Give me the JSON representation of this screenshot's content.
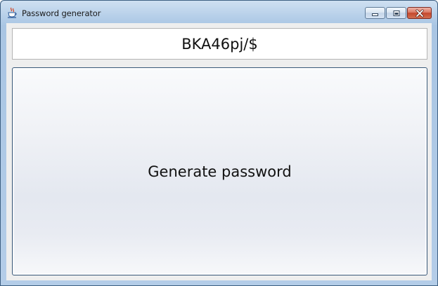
{
  "window": {
    "title": "Password generator",
    "icon": "java-cup-icon"
  },
  "caption_buttons": {
    "minimize": "minimize-icon",
    "restore": "restore-icon",
    "close": "close-icon"
  },
  "password_field": {
    "value": "BKA46pj/$"
  },
  "generate_button": {
    "label": "Generate password"
  },
  "colors": {
    "title_bar": "#b9d1ea",
    "client_background": "#eeeeee",
    "close_button": "#c4462c",
    "button_border": "#3b5a7a"
  }
}
